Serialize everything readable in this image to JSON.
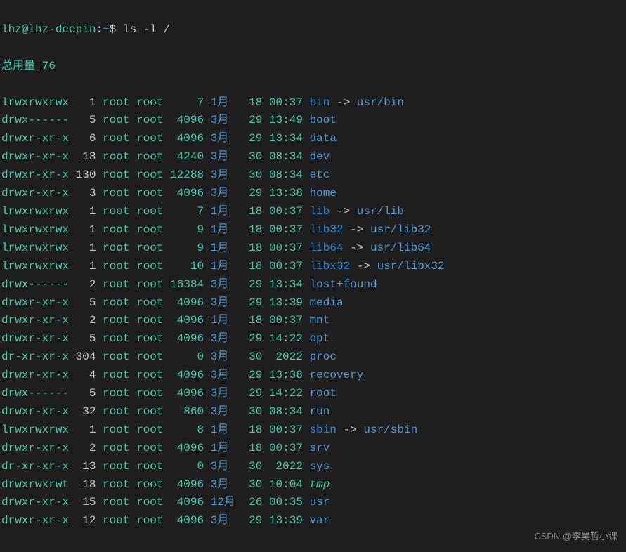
{
  "prompt": {
    "user": "lhz",
    "at": "@",
    "host": "lhz-deepin",
    "colon": ":",
    "path": "~",
    "dollar": "$",
    "command": "ls -l /"
  },
  "total_label": "总用量",
  "total_value": "76",
  "rows": [
    {
      "perms": "lrwxrwxrwx",
      "links": "1",
      "owner": "root",
      "group": "root",
      "size": "7",
      "month": "1月",
      "day": "18",
      "time": "00:37",
      "name": "bin",
      "type": "link",
      "target": "usr/bin"
    },
    {
      "perms": "drwx------",
      "links": "5",
      "owner": "root",
      "group": "root",
      "size": "4096",
      "month": "3月",
      "day": "29",
      "time": "13:49",
      "name": "boot",
      "type": "dir"
    },
    {
      "perms": "drwxr-xr-x",
      "links": "6",
      "owner": "root",
      "group": "root",
      "size": "4096",
      "month": "3月",
      "day": "29",
      "time": "13:34",
      "name": "data",
      "type": "dir"
    },
    {
      "perms": "drwxr-xr-x",
      "links": "18",
      "owner": "root",
      "group": "root",
      "size": "4240",
      "month": "3月",
      "day": "30",
      "time": "08:34",
      "name": "dev",
      "type": "dir"
    },
    {
      "perms": "drwxr-xr-x",
      "links": "130",
      "owner": "root",
      "group": "root",
      "size": "12288",
      "month": "3月",
      "day": "30",
      "time": "08:34",
      "name": "etc",
      "type": "dir"
    },
    {
      "perms": "drwxr-xr-x",
      "links": "3",
      "owner": "root",
      "group": "root",
      "size": "4096",
      "month": "3月",
      "day": "29",
      "time": "13:38",
      "name": "home",
      "type": "dir"
    },
    {
      "perms": "lrwxrwxrwx",
      "links": "1",
      "owner": "root",
      "group": "root",
      "size": "7",
      "month": "1月",
      "day": "18",
      "time": "00:37",
      "name": "lib",
      "type": "link",
      "target": "usr/lib"
    },
    {
      "perms": "lrwxrwxrwx",
      "links": "1",
      "owner": "root",
      "group": "root",
      "size": "9",
      "month": "1月",
      "day": "18",
      "time": "00:37",
      "name": "lib32",
      "type": "link",
      "target": "usr/lib32"
    },
    {
      "perms": "lrwxrwxrwx",
      "links": "1",
      "owner": "root",
      "group": "root",
      "size": "9",
      "month": "1月",
      "day": "18",
      "time": "00:37",
      "name": "lib64",
      "type": "link",
      "target": "usr/lib64"
    },
    {
      "perms": "lrwxrwxrwx",
      "links": "1",
      "owner": "root",
      "group": "root",
      "size": "10",
      "month": "1月",
      "day": "18",
      "time": "00:37",
      "name": "libx32",
      "type": "link",
      "target": "usr/libx32"
    },
    {
      "perms": "drwx------",
      "links": "2",
      "owner": "root",
      "group": "root",
      "size": "16384",
      "month": "3月",
      "day": "29",
      "time": "13:34",
      "name": "lost+found",
      "type": "dir"
    },
    {
      "perms": "drwxr-xr-x",
      "links": "5",
      "owner": "root",
      "group": "root",
      "size": "4096",
      "month": "3月",
      "day": "29",
      "time": "13:39",
      "name": "media",
      "type": "dir"
    },
    {
      "perms": "drwxr-xr-x",
      "links": "2",
      "owner": "root",
      "group": "root",
      "size": "4096",
      "month": "1月",
      "day": "18",
      "time": "00:37",
      "name": "mnt",
      "type": "dir"
    },
    {
      "perms": "drwxr-xr-x",
      "links": "5",
      "owner": "root",
      "group": "root",
      "size": "4096",
      "month": "3月",
      "day": "29",
      "time": "14:22",
      "name": "opt",
      "type": "dir"
    },
    {
      "perms": "dr-xr-xr-x",
      "links": "304",
      "owner": "root",
      "group": "root",
      "size": "0",
      "month": "3月",
      "day": "30",
      "time": "2022",
      "name": "proc",
      "type": "dir"
    },
    {
      "perms": "drwxr-xr-x",
      "links": "4",
      "owner": "root",
      "group": "root",
      "size": "4096",
      "month": "3月",
      "day": "29",
      "time": "13:38",
      "name": "recovery",
      "type": "dir"
    },
    {
      "perms": "drwx------",
      "links": "5",
      "owner": "root",
      "group": "root",
      "size": "4096",
      "month": "3月",
      "day": "29",
      "time": "14:22",
      "name": "root",
      "type": "dir"
    },
    {
      "perms": "drwxr-xr-x",
      "links": "32",
      "owner": "root",
      "group": "root",
      "size": "860",
      "month": "3月",
      "day": "30",
      "time": "08:34",
      "name": "run",
      "type": "dir"
    },
    {
      "perms": "lrwxrwxrwx",
      "links": "1",
      "owner": "root",
      "group": "root",
      "size": "8",
      "month": "1月",
      "day": "18",
      "time": "00:37",
      "name": "sbin",
      "type": "link",
      "target": "usr/sbin"
    },
    {
      "perms": "drwxr-xr-x",
      "links": "2",
      "owner": "root",
      "group": "root",
      "size": "4096",
      "month": "1月",
      "day": "18",
      "time": "00:37",
      "name": "srv",
      "type": "dir"
    },
    {
      "perms": "dr-xr-xr-x",
      "links": "13",
      "owner": "root",
      "group": "root",
      "size": "0",
      "month": "3月",
      "day": "30",
      "time": "2022",
      "name": "sys",
      "type": "dir"
    },
    {
      "perms": "drwxrwxrwt",
      "links": "18",
      "owner": "root",
      "group": "root",
      "size": "4096",
      "month": "3月",
      "day": "30",
      "time": "10:04",
      "name": "tmp",
      "type": "sticky"
    },
    {
      "perms": "drwxr-xr-x",
      "links": "15",
      "owner": "root",
      "group": "root",
      "size": "4096",
      "month": "12月",
      "day": "26",
      "time": "00:35",
      "name": "usr",
      "type": "dir"
    },
    {
      "perms": "drwxr-xr-x",
      "links": "12",
      "owner": "root",
      "group": "root",
      "size": "4096",
      "month": "3月",
      "day": "29",
      "time": "13:39",
      "name": "var",
      "type": "dir"
    }
  ],
  "watermark": "CSDN @李昊哲小课"
}
